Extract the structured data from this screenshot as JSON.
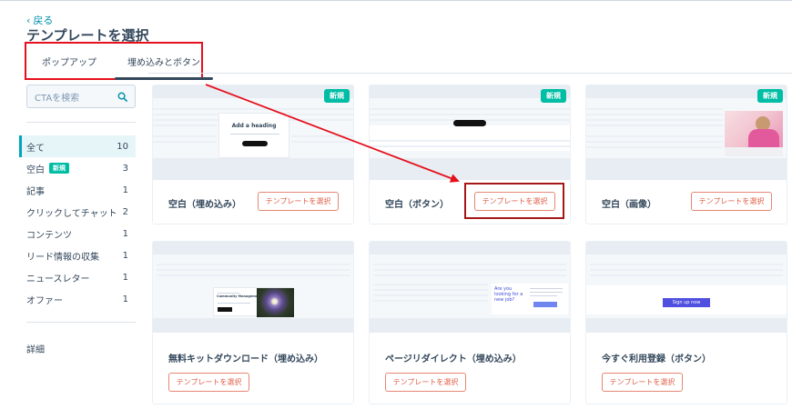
{
  "header": {
    "back_label": "戻る",
    "title": "テンプレートを選択"
  },
  "tabs": [
    {
      "label": "ポップアップ",
      "active": false
    },
    {
      "label": "埋め込みとボタン",
      "active": true
    }
  ],
  "sidebar": {
    "search_placeholder": "CTAを検索",
    "items": [
      {
        "label": "全て",
        "count": "10",
        "active": true,
        "badge": ""
      },
      {
        "label": "空白",
        "count": "3",
        "active": false,
        "badge": "新規"
      },
      {
        "label": "記事",
        "count": "1",
        "active": false,
        "badge": ""
      },
      {
        "label": "クリックしてチャット",
        "count": "2",
        "active": false,
        "badge": ""
      },
      {
        "label": "コンテンツ",
        "count": "1",
        "active": false,
        "badge": ""
      },
      {
        "label": "リード情報の収集",
        "count": "1",
        "active": false,
        "badge": ""
      },
      {
        "label": "ニュースレター",
        "count": "1",
        "active": false,
        "badge": ""
      },
      {
        "label": "オファー",
        "count": "1",
        "active": false,
        "badge": ""
      }
    ],
    "detail_label": "詳細"
  },
  "cards": [
    {
      "name": "空白（埋め込み）",
      "button": "テンプレートを選択",
      "badge": "新規",
      "preview_heading": "Add a heading"
    },
    {
      "name": "空白（ボタン）",
      "button": "テンプレートを選択",
      "badge": "新規"
    },
    {
      "name": "空白（画像）",
      "button": "テンプレートを選択",
      "badge": "新規"
    },
    {
      "name": "無料キットダウンロード（埋め込み）",
      "button": "テンプレートを選択",
      "preview_title": "Community Management"
    },
    {
      "name": "ページリダイレクト（埋め込み）",
      "button": "テンプレートを選択",
      "preview_text": "Are you looking for a new job?"
    },
    {
      "name": "今すぐ利用登録（ボタン）",
      "button": "テンプレートを選択",
      "preview_button": "Sign up now"
    }
  ],
  "colors": {
    "accent": "#00a4bd",
    "badge": "#00bda5",
    "select_button": "#e0614a",
    "annotation": "#e5101d",
    "annotation_box": "#a51717"
  }
}
